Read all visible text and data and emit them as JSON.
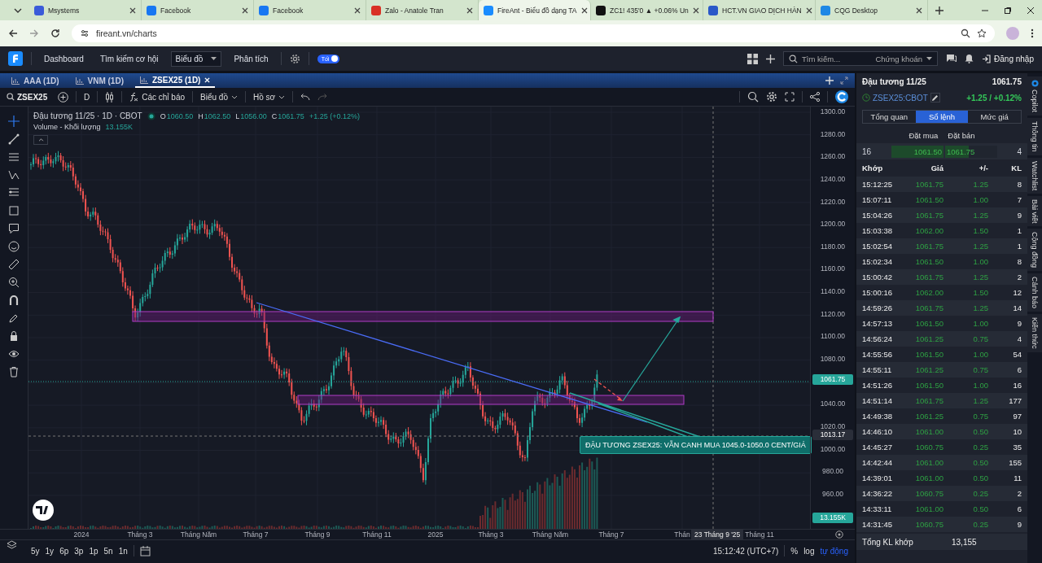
{
  "browser": {
    "tabs": [
      {
        "title": "Msystems",
        "selected": false
      },
      {
        "title": "Facebook",
        "selected": false
      },
      {
        "title": "Facebook",
        "selected": false
      },
      {
        "title": "Zalo - Anatole Tran",
        "selected": false
      },
      {
        "title": "FireAnt - Biểu đồ dạng TA",
        "selected": true
      },
      {
        "title": "ZC1! 435'0 ▲ +0.06% Un",
        "selected": false
      },
      {
        "title": "HCT.VN GIAO DỊCH HÀN",
        "selected": false
      },
      {
        "title": "CQG Desktop",
        "selected": false
      }
    ],
    "url": "fireant.vn/charts"
  },
  "header": {
    "nav": [
      {
        "label": "Dashboard",
        "selected": false
      },
      {
        "label": "Tìm kiếm cơ hội",
        "selected": false
      },
      {
        "label": "Biểu đồ",
        "selected": true
      },
      {
        "label": "Phân tích",
        "selected": false
      }
    ],
    "theme_toggle": {
      "label": "Tối",
      "on": true
    },
    "search": {
      "placeholder": "Tìm kiếm...",
      "scope": "Chứng khoán"
    },
    "login": "Đăng nhập"
  },
  "chart_tabs": [
    {
      "label": "AAA (1D)",
      "selected": false
    },
    {
      "label": "VNM (1D)",
      "selected": false
    },
    {
      "label": "ZSEX25 (1D)",
      "selected": true
    }
  ],
  "toolbar": {
    "symbol": "ZSEX25",
    "interval": "D",
    "indicators": "Các chỉ báo",
    "chart_menu": "Biểu đồ",
    "profile_menu": "Hồ sơ"
  },
  "legend": {
    "title": "Đậu tương 11/25 · 1D · CBOT",
    "ohlc": [
      {
        "key": "O",
        "value": "1060.50"
      },
      {
        "key": "H",
        "value": "1062.50"
      },
      {
        "key": "L",
        "value": "1056.00"
      },
      {
        "key": "C",
        "value": "1061.75"
      }
    ],
    "change": "+1.25 (+0.12%)",
    "volume_label": "Volume - Khối lượng",
    "volume_value": "13.155K"
  },
  "chart": {
    "y_labels": [
      "1300.00",
      "1280.00",
      "1260.00",
      "1240.00",
      "1220.00",
      "1200.00",
      "1180.00",
      "1160.00",
      "1140.00",
      "1120.00",
      "1100.00",
      "1080.00",
      "1040.00",
      "1020.00",
      "1000.00",
      "980.00",
      "960.00"
    ],
    "x_labels": [
      "2024",
      "Tháng 3",
      "Tháng Năm",
      "Tháng 7",
      "Tháng 9",
      "Tháng 11",
      "2025",
      "Tháng 3",
      "Tháng Năm",
      "Tháng 7",
      "Thán",
      "Tháng 11"
    ],
    "crosshair_date": "23 Tháng 9 '25",
    "price_tags": [
      {
        "kind": "last",
        "text": "1061.75"
      },
      {
        "kind": "crosshair",
        "text": "1013.17"
      },
      {
        "kind": "volume",
        "text": "13.155K"
      }
    ],
    "annotation": "ĐẬU TƯƠNG ZSEX25: VẪN CANH MUA 1045.0-1050.0 CENT/GIÁ"
  },
  "bottom_bar": {
    "ranges": [
      "5y",
      "1y",
      "6p",
      "3p",
      "1p",
      "5n",
      "1n"
    ],
    "time": "15:12:42 (UTC+7)",
    "scales": [
      {
        "label": "%",
        "selected": false
      },
      {
        "label": "log",
        "selected": false
      },
      {
        "label": "tự động",
        "selected": true
      }
    ]
  },
  "panel": {
    "name": "Đậu tương 11/25",
    "price": "1061.75",
    "symbol": "ZSEX25:CBOT",
    "change": "+1.25 / +0.12%",
    "tabs": [
      {
        "label": "Tổng quan",
        "selected": false
      },
      {
        "label": "Sổ lệnh",
        "selected": true
      },
      {
        "label": "Mức giá",
        "selected": false
      }
    ],
    "book_headers": [
      "Đặt mua",
      "Đặt bán"
    ],
    "book_row": {
      "bid_volume": "16",
      "bid_price": "1061.50",
      "ask_price": "1061.75",
      "ask_volume": "4",
      "bid_depth": {
        "level": 1.0
      },
      "ask_depth": {
        "level": 0.45
      }
    },
    "trade_columns": [
      "Khớp",
      "Giá",
      "+/-",
      "KL"
    ],
    "trades": [
      [
        "15:12:25",
        "1061.75",
        "1.25",
        "8"
      ],
      [
        "15:07:11",
        "1061.50",
        "1.00",
        "7"
      ],
      [
        "15:04:26",
        "1061.75",
        "1.25",
        "9"
      ],
      [
        "15:03:38",
        "1062.00",
        "1.50",
        "1"
      ],
      [
        "15:02:54",
        "1061.75",
        "1.25",
        "1"
      ],
      [
        "15:02:34",
        "1061.50",
        "1.00",
        "8"
      ],
      [
        "15:00:42",
        "1061.75",
        "1.25",
        "2"
      ],
      [
        "15:00:16",
        "1062.00",
        "1.50",
        "12"
      ],
      [
        "14:59:26",
        "1061.75",
        "1.25",
        "14"
      ],
      [
        "14:57:13",
        "1061.50",
        "1.00",
        "9"
      ],
      [
        "14:56:24",
        "1061.25",
        "0.75",
        "4"
      ],
      [
        "14:55:56",
        "1061.50",
        "1.00",
        "54"
      ],
      [
        "14:55:11",
        "1061.25",
        "0.75",
        "6"
      ],
      [
        "14:51:26",
        "1061.50",
        "1.00",
        "16"
      ],
      [
        "14:51:14",
        "1061.75",
        "1.25",
        "177"
      ],
      [
        "14:49:38",
        "1061.25",
        "0.75",
        "97"
      ],
      [
        "14:46:10",
        "1061.00",
        "0.50",
        "10"
      ],
      [
        "14:45:27",
        "1060.75",
        "0.25",
        "35"
      ],
      [
        "14:42:44",
        "1061.00",
        "0.50",
        "155"
      ],
      [
        "14:39:01",
        "1061.00",
        "0.50",
        "11"
      ],
      [
        "14:36:22",
        "1060.75",
        "0.25",
        "2"
      ],
      [
        "14:33:11",
        "1061.00",
        "0.50",
        "6"
      ],
      [
        "14:31:45",
        "1060.75",
        "0.25",
        "9"
      ]
    ],
    "total_label": "Tổng KL khớp",
    "total_value": "13,155"
  },
  "side_tabs": [
    "Copilot",
    "Thông tin",
    "Watchlist",
    "Bài viết",
    "Cộng đồng",
    "Cảnh báo",
    "Kiến thức"
  ]
}
